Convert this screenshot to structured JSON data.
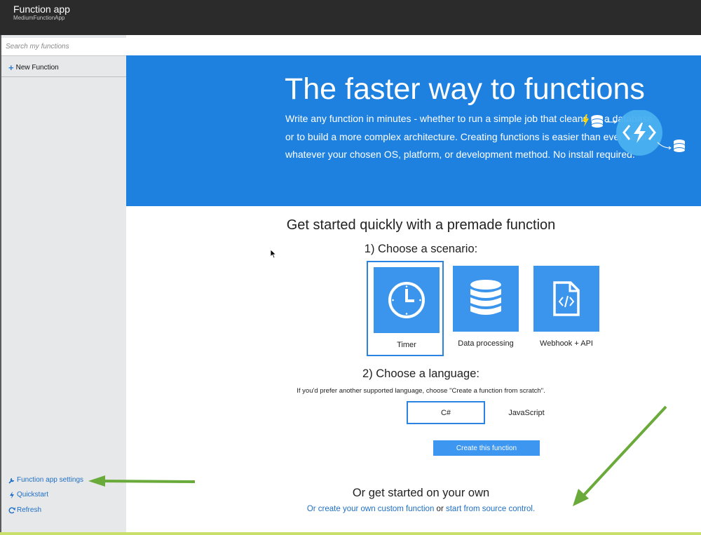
{
  "header": {
    "title": "Function app",
    "subtitle": "MediumFunctionApp"
  },
  "sidebar": {
    "search_placeholder": "Search my functions",
    "new_function_label": "New Function",
    "bottom_links": [
      {
        "label": "Function app settings",
        "icon": "wrench-icon"
      },
      {
        "label": "Quickstart",
        "icon": "bolt-icon"
      },
      {
        "label": "Refresh",
        "icon": "refresh-icon"
      }
    ]
  },
  "hero": {
    "title": "The faster way to functions",
    "description": "Write any function in minutes - whether to run a simple job that cleans up a database or to build a more complex architecture. Creating functions is easier than ever before, whatever your chosen OS, platform, or development method. No install required."
  },
  "main": {
    "heading": "Get started quickly with a premade function",
    "step1_label": "1) Choose a scenario:",
    "scenarios": [
      {
        "label": "Timer",
        "icon": "clock-icon",
        "selected": true
      },
      {
        "label": "Data processing",
        "icon": "database-icon",
        "selected": false
      },
      {
        "label": "Webhook + API",
        "icon": "code-file-icon",
        "selected": false
      }
    ],
    "step2_label": "2) Choose a language:",
    "step2_note": "If you'd prefer another supported language, choose \"Create a function from scratch\".",
    "languages": [
      {
        "label": "C#",
        "selected": true
      },
      {
        "label": "JavaScript",
        "selected": false
      }
    ],
    "create_button": "Create this function",
    "own_heading": "Or get started on your own",
    "own_link_custom": "Or create your own custom function",
    "own_link_or": "or",
    "own_link_source": "start from source control."
  },
  "colors": {
    "hero_bg": "#1e81e0",
    "tile_bg": "#3b95ec",
    "link": "#1e6fc5",
    "annotation_arrow": "#6aaa3a"
  }
}
